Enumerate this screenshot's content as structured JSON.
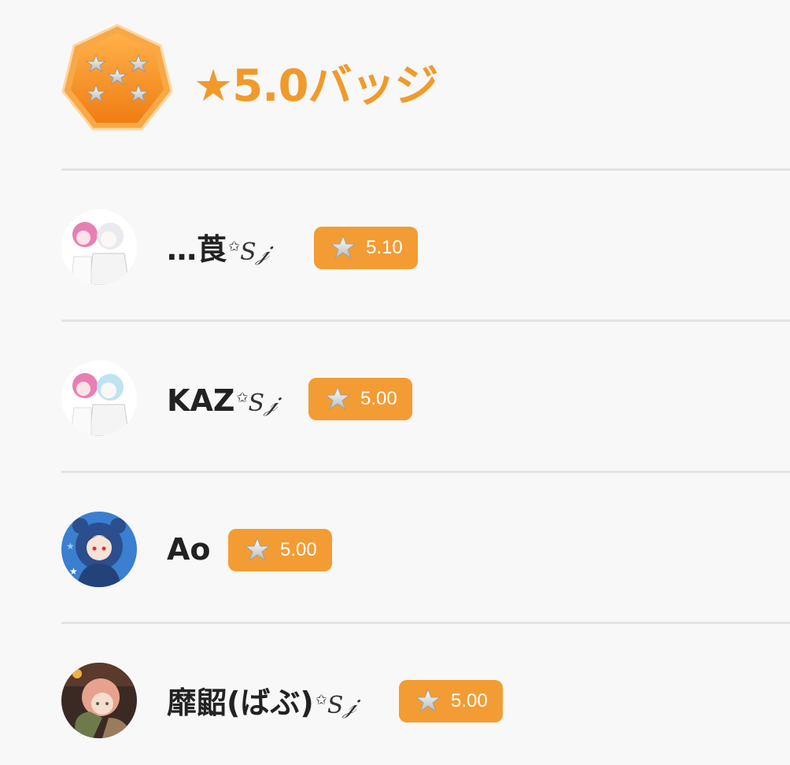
{
  "header": {
    "title": "★5.0バッジ",
    "badge_icon": "five-star-heptagon-badge"
  },
  "colors": {
    "accent": "#f39c33",
    "title": "#f09a2c",
    "background": "#f8f8f8",
    "divider": "#e3e3e3"
  },
  "users": [
    {
      "name": "…莨",
      "deco": "S",
      "score": "5.10",
      "avatar": "anime-duo-pink-white"
    },
    {
      "name": "KAZ",
      "deco": "S",
      "score": "5.00",
      "avatar": "anime-duo-pink-blue"
    },
    {
      "name": "Ao",
      "deco": "",
      "score": "5.00",
      "avatar": "anime-hood-blue"
    },
    {
      "name": "靡鼦(ばぶ)",
      "deco": "S",
      "score": "5.00",
      "avatar": "anime-pink-hair-night"
    }
  ]
}
